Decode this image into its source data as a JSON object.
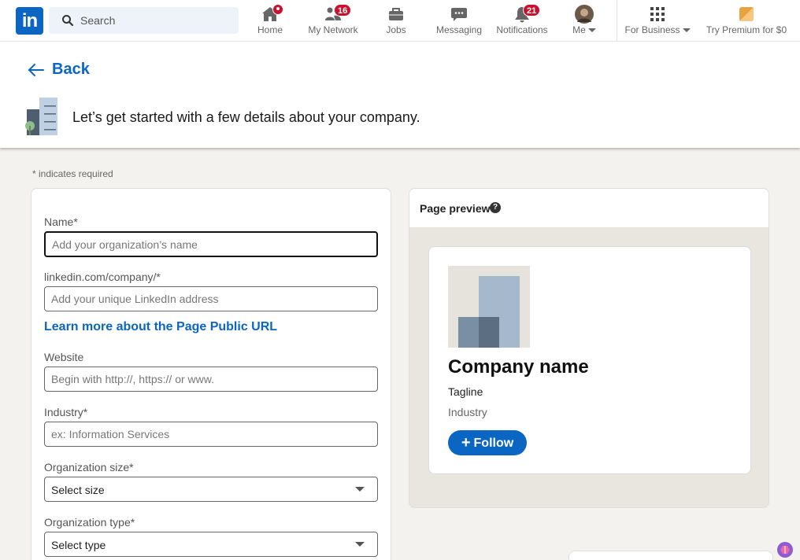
{
  "nav": {
    "logo": "in",
    "search_placeholder": "Search",
    "items": [
      {
        "label": "Home",
        "icon": "home-icon",
        "badge": "dot"
      },
      {
        "label": "My Network",
        "icon": "network-icon",
        "badge": "16"
      },
      {
        "label": "Jobs",
        "icon": "briefcase-icon",
        "badge": ""
      },
      {
        "label": "Messaging",
        "icon": "chat-icon",
        "badge": ""
      },
      {
        "label": "Notifications",
        "icon": "bell-icon",
        "badge": "21"
      },
      {
        "label": "Me",
        "icon": "avatar",
        "badge": ""
      },
      {
        "label": "For Business",
        "icon": "grid-icon",
        "badge": ""
      },
      {
        "label": "Try Premium for $0",
        "icon": "premium-icon",
        "badge": ""
      }
    ]
  },
  "header": {
    "back_label": "Back",
    "intro": "Let’s get started with a few details about your company."
  },
  "form": {
    "required_note": "*  indicates required",
    "name_label": "Name*",
    "name_placeholder": "Add your organization’s name",
    "url_label": "linkedin.com/company/*",
    "url_placeholder": "Add your unique LinkedIn address",
    "learn_more": "Learn more about the Page Public URL",
    "website_label": "Website",
    "website_placeholder": "Begin with http://, https:// or www.",
    "industry_label": "Industry*",
    "industry_placeholder": "ex: Information Services",
    "size_label": "Organization size*",
    "size_value": "Select size",
    "type_label": "Organization type*",
    "type_value": "Select type"
  },
  "preview": {
    "title": "Page preview",
    "company_name": "Company name",
    "tagline": "Tagline",
    "industry": "Industry",
    "follow_label": "Follow"
  },
  "colors": {
    "brand": "#0a66c2",
    "badge": "#cb112d",
    "page_bg": "#f4f2ee"
  }
}
